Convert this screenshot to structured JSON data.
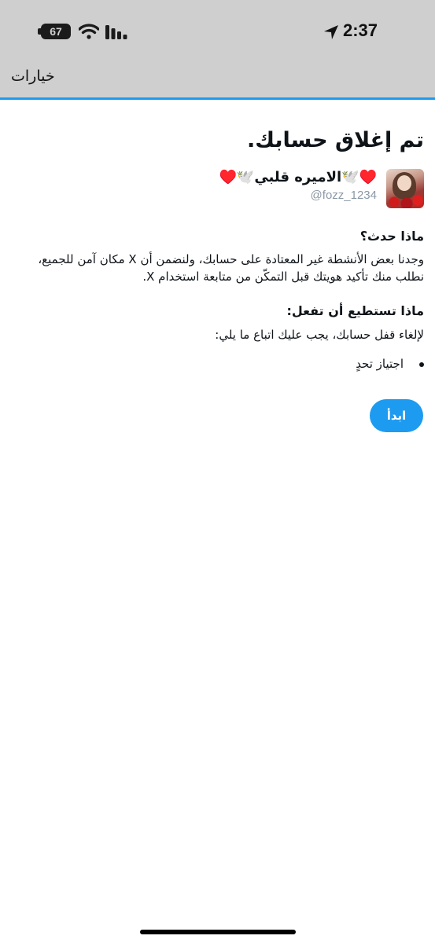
{
  "status_bar": {
    "battery": "67",
    "time": "2:37",
    "icons": [
      "wifi-icon",
      "cellular-signal-icon",
      "location-arrow-icon"
    ]
  },
  "header": {
    "options_label": "خيارات",
    "accent_color": "#1d9bf0"
  },
  "main": {
    "title": "تم إغلاق حسابك.",
    "account": {
      "display_name": "♥️🕊️الاميره قلبي🕊️♥️",
      "handle": "@fozz_1234"
    },
    "what_happened": {
      "heading": "ماذا حدث؟",
      "body": "وجدنا بعض الأنشطة غير المعتادة على حسابك، ولنضمن أن X مكان آمن للجميع، نطلب منك تأكيد هويتك قبل التمكّن من متابعة استخدام X."
    },
    "what_you_can_do": {
      "heading": "ماذا تستطيع أن تفعل:",
      "body": "لإلغاء قفل حسابك، يجب عليك اتباع ما يلي:",
      "steps": [
        "اجتياز تحدٍ"
      ]
    },
    "start_button": "ابدأ"
  }
}
